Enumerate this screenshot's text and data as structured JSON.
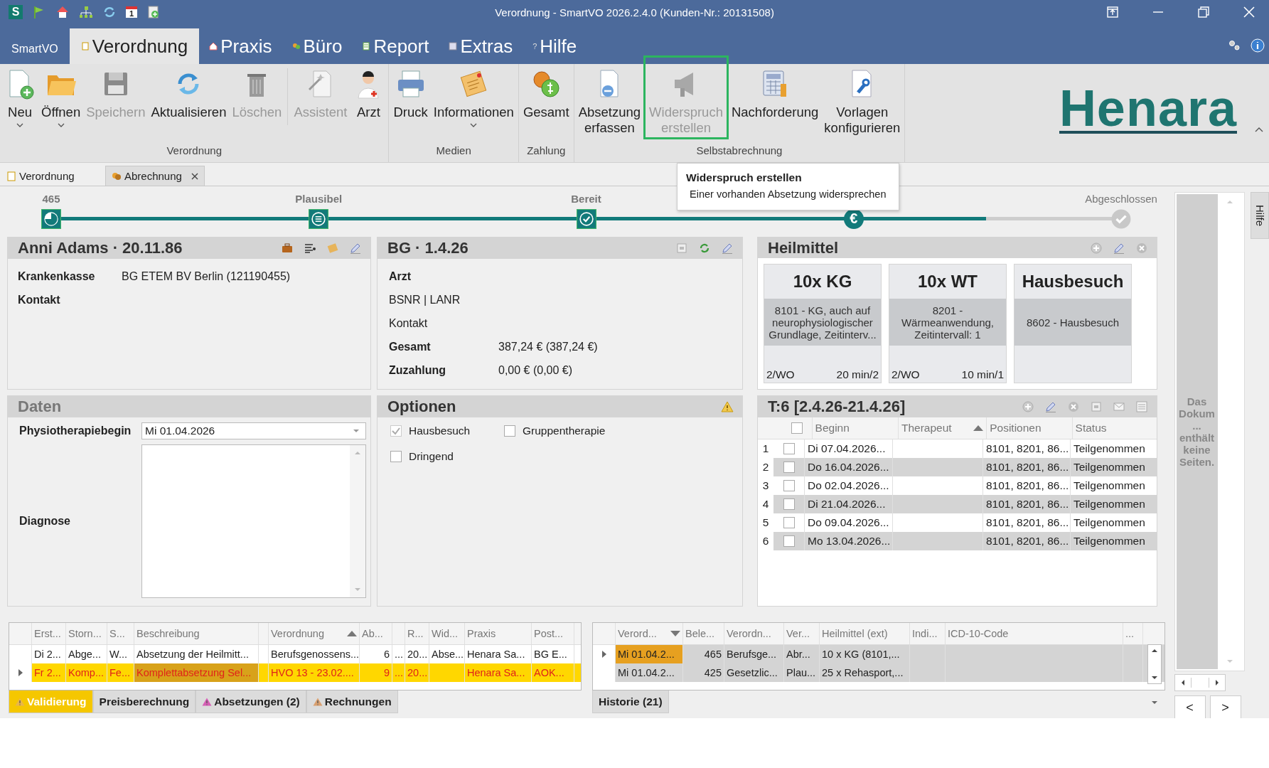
{
  "window": {
    "title": "Verordnung - SmartVO 2026.2.4.0 (Kunden-Nr.: 20131508)"
  },
  "quick_access": {
    "app_logo": "S",
    "calendar_day": "1"
  },
  "app_button": "SmartVO",
  "menu_tabs": [
    {
      "label": "Verordnung",
      "selected": true
    },
    {
      "label": "Praxis",
      "selected": false
    },
    {
      "label": "Büro",
      "selected": false
    },
    {
      "label": "Report",
      "selected": false
    },
    {
      "label": "Extras",
      "selected": false
    },
    {
      "label": "Hilfe",
      "selected": false,
      "icon_text": "?"
    }
  ],
  "ribbon": {
    "groups": [
      {
        "label": "Verordnung",
        "buttons": [
          {
            "label": "Neu",
            "disabled": false,
            "dropdown": true
          },
          {
            "label": "Öffnen",
            "disabled": false,
            "dropdown": true
          },
          {
            "label": "Speichern",
            "disabled": true
          },
          {
            "label": "Aktualisieren",
            "disabled": false
          },
          {
            "label": "Löschen",
            "disabled": true
          },
          {
            "label": "Assistent",
            "disabled": true,
            "separator_before": true
          },
          {
            "label": "Arzt",
            "disabled": false
          }
        ]
      },
      {
        "label": "Medien",
        "buttons": [
          {
            "label": "Druck",
            "disabled": false
          },
          {
            "label": "Informationen",
            "disabled": false,
            "dropdown": true
          }
        ]
      },
      {
        "label": "Zahlung",
        "buttons": [
          {
            "label": "Gesamt",
            "disabled": false
          }
        ]
      },
      {
        "label": "Selbstabrechnung",
        "buttons": [
          {
            "label": "Absetzung\nerfassen",
            "disabled": false
          },
          {
            "label": "Widerspruch\nerstellen",
            "disabled": true,
            "highlighted": true
          },
          {
            "label": "Nachforderung",
            "disabled": false
          },
          {
            "label": "Vorlagen\nkonfigurieren",
            "disabled": false
          }
        ]
      }
    ]
  },
  "logo": "Henara",
  "tooltip": {
    "title": "Widerspruch erstellen",
    "text": "Einer vorhanden Absetzung widersprechen"
  },
  "doc_tabs": [
    {
      "label": "Verordnung",
      "selected": true,
      "closable": false
    },
    {
      "label": "Abrechnung",
      "selected": false,
      "closable": true
    }
  ],
  "progress": {
    "level": 0.874,
    "steps": [
      {
        "label": "465",
        "reached": true
      },
      {
        "label": "Plausibel",
        "reached": true
      },
      {
        "label": "Bereit",
        "reached": true
      },
      {
        "symbol": "€",
        "reached": true
      },
      {
        "label": "Abgeschlossen",
        "reached": false
      }
    ]
  },
  "patient": {
    "title": "Anni Adams · 20.11.86",
    "fields": [
      {
        "label": "Krankenkasse",
        "value": "BG ETEM BV Berlin (121190455)"
      },
      {
        "label": "Kontakt"
      }
    ]
  },
  "prescription": {
    "title": "BG  · 1.4.26",
    "fields": [
      {
        "label": "Arzt",
        "bold": true
      },
      {
        "label": "BSNR | LANR",
        "bold": false
      },
      {
        "label": "Kontakt",
        "bold": false
      },
      {
        "label": "Gesamt",
        "bold": true,
        "value": "387,24 € (387,24 €)"
      },
      {
        "label": "Zuzahlung",
        "bold": true,
        "value": "0,00 € (0,00 €)"
      }
    ]
  },
  "heilmittel": {
    "title": "Heilmittel",
    "cards": [
      {
        "title": "10x KG",
        "description": "8101 - KG, auch auf neurophysiologischer Grundlage, Zeitinterv...",
        "frequency": "2/WO",
        "duration": "20 min/2"
      },
      {
        "title": "10x WT",
        "description": "8201 - Wärmeanwendung, Zeitintervall: 1",
        "frequency": "2/WO",
        "duration": "10 min/1"
      },
      {
        "title": "Hausbesuch",
        "description": "8602 - Hausbesuch"
      }
    ]
  },
  "daten": {
    "title": "Daten",
    "start_label": "Physiotherapiebegin",
    "start_value": "Mi 01.04.2026",
    "diagnose_label": "Diagnose"
  },
  "optionen": {
    "title": "Optionen",
    "options": [
      {
        "label": "Hausbesuch",
        "checked": true
      },
      {
        "label": "Gruppentherapie",
        "checked": false
      },
      {
        "label": "Dringend",
        "checked": false
      }
    ]
  },
  "termine": {
    "title": "T:6 [2.4.26-21.4.26]",
    "all_checked": false,
    "columns": [
      {
        "label": "Beginn"
      },
      {
        "label": "Therapeut",
        "sort_up": true
      },
      {
        "label": "Positionen"
      },
      {
        "label": "Status"
      }
    ],
    "rows": [
      {
        "number": "1",
        "checked": false,
        "beginn": "Di 07.04.2026...",
        "positionen": "8101, 8201, 86...",
        "status": "Teilgenommen"
      },
      {
        "number": "2",
        "checked": false,
        "beginn": "Do 16.04.2026...",
        "positionen": "8101, 8201, 86...",
        "status": "Teilgenommen"
      },
      {
        "number": "3",
        "checked": false,
        "beginn": "Do 02.04.2026...",
        "positionen": "8101, 8201, 86...",
        "status": "Teilgenommen"
      },
      {
        "number": "4",
        "checked": false,
        "beginn": "Di 21.04.2026...",
        "positionen": "8101, 8201, 86...",
        "status": "Teilgenommen"
      },
      {
        "number": "5",
        "checked": false,
        "beginn": "Do 09.04.2026...",
        "positionen": "8101, 8201, 86...",
        "status": "Teilgenommen"
      },
      {
        "number": "6",
        "checked": false,
        "beginn": "Mo 13.04.2026...",
        "positionen": "8101, 8201, 86...",
        "status": "Teilgenommen"
      }
    ]
  },
  "absetzungen_grid": {
    "columns": [
      {
        "label": "Erst..."
      },
      {
        "label": "Storn..."
      },
      {
        "label": "S..."
      },
      {
        "label": "Beschreibung"
      },
      {},
      {
        "label": "Verordnung",
        "sort_up": true
      },
      {
        "label": "Ab..."
      },
      {},
      {
        "label": "R..."
      },
      {
        "label": "Wid..."
      },
      {
        "label": "Praxis"
      },
      {
        "label": "Post..."
      }
    ],
    "rows": [
      {
        "selected": false,
        "error": false,
        "cells": [
          "Di 2...",
          "Abge...",
          "W...",
          "Absetzung der Heilmitt...",
          null,
          "Berufsgenossens...",
          "6",
          "...",
          "20...",
          "Abse...",
          "Henara Sa...",
          "BG E..."
        ]
      },
      {
        "selected": true,
        "error": true,
        "cells": [
          "Fr 2...",
          "Komp...",
          "Fe...",
          {
            "text": "Komplettabsetzung Sel...",
            "focused": true
          },
          null,
          "HVO 13 - 23.02....",
          "9",
          "...",
          "20...",
          null,
          "Henara Sa...",
          "AOK..."
        ]
      }
    ]
  },
  "bottom_tabs": [
    {
      "label": "Validierung",
      "selected": true,
      "warning": true,
      "color": "#e8b64a"
    },
    {
      "label": "Preisberechnung",
      "selected": false,
      "warning": false
    },
    {
      "label": "Absetzungen (2)",
      "selected": false,
      "warning": true,
      "color": "#d65fb5"
    },
    {
      "label": "Rechnungen",
      "selected": false,
      "warning": true,
      "color": "#d9a070"
    }
  ],
  "history_grid": {
    "columns": [
      {
        "label": "Verord...",
        "sort_up": false
      },
      {
        "label": "Bele..."
      },
      {
        "label": "Verordn..."
      },
      {
        "label": "Ver..."
      },
      {
        "label": "Heilmittel (ext)"
      },
      {
        "label": "Indi..."
      },
      {
        "label": "ICD-10-Code"
      },
      {
        "label": "..."
      }
    ],
    "rows": [
      {
        "selected": true,
        "cells": [
          {
            "text": "Mi 01.04.2...",
            "focused": true
          },
          "465",
          "Berufsge...",
          "Abr...",
          "10 x KG (8101,...",
          null,
          null,
          null
        ]
      },
      {
        "selected": false,
        "cells": [
          "Mi 01.04.2...",
          "425",
          "Gesetzlic...",
          "Plau...",
          "25 x Rehasport,...",
          null,
          null,
          null
        ]
      }
    ]
  },
  "history_tab": "Historie (21)",
  "viewer": {
    "message": "Das Dokum... enthält keine Seiten.",
    "prev": "<",
    "next": ">"
  },
  "help_tab": "Hilfe"
}
